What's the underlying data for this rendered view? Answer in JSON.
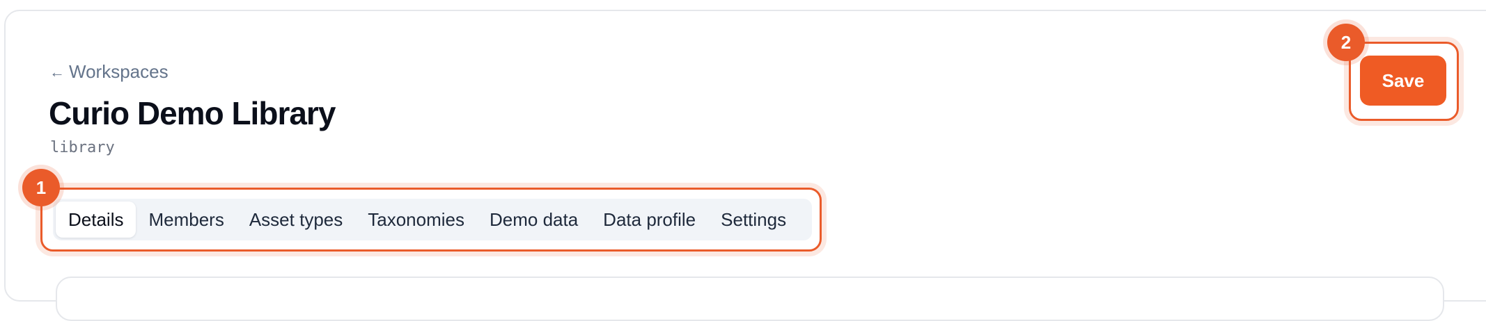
{
  "header": {
    "back_label": "Workspaces",
    "back_icon": "arrow-left-icon",
    "title": "Curio Demo Library",
    "slug": "library"
  },
  "tabs": [
    {
      "label": "Details",
      "active": true
    },
    {
      "label": "Members",
      "active": false
    },
    {
      "label": "Asset types",
      "active": false
    },
    {
      "label": "Taxonomies",
      "active": false
    },
    {
      "label": "Demo data",
      "active": false
    },
    {
      "label": "Data profile",
      "active": false
    },
    {
      "label": "Settings",
      "active": false
    }
  ],
  "toolbar": {
    "save_label": "Save"
  },
  "annotations": {
    "marker_1": "1",
    "marker_2": "2"
  },
  "colors": {
    "accent": "#ef5b24",
    "muted_text": "#64748b",
    "tab_bg": "#f1f4f8"
  }
}
